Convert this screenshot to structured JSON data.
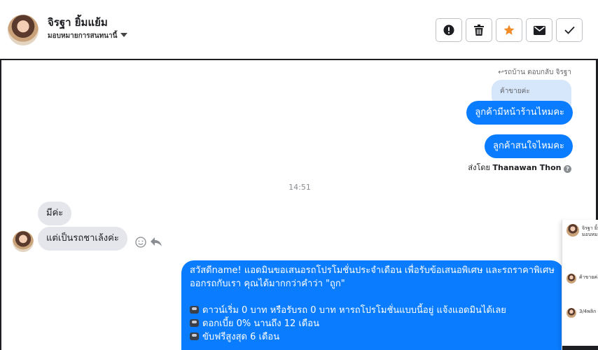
{
  "header": {
    "contact_name": "จิรฐา ยิ้มแย้ม",
    "assign_label": "มอบหมายการสนทนานี้",
    "actions": [
      {
        "name": "spam-button",
        "icon": "alert-icon",
        "color": "#1c1e21"
      },
      {
        "name": "delete-button",
        "icon": "trash-icon",
        "color": "#1c1e21"
      },
      {
        "name": "star-button",
        "icon": "star-icon",
        "color": "#f28c28"
      },
      {
        "name": "mail-button",
        "icon": "mail-icon",
        "color": "#1c1e21"
      },
      {
        "name": "done-button",
        "icon": "check-icon",
        "color": "#1c1e21"
      }
    ]
  },
  "conversation": {
    "reply_label": "↩รถบ้าน ตอบกลับ จิรฐา",
    "quoted_text": "ค้าขายค่ะ",
    "outgoing_1": "ลูกค้ามีหน้าร้านไหมคะ",
    "outgoing_2": "ลูกค้าสนใจไหมคะ",
    "sent_by_prefix": "ส่งโดย",
    "sent_by_name": "Thanawan Thon",
    "timestamp": "14:51",
    "incoming_1": "มีค่ะ",
    "incoming_2": "แต่เป็นรถชาเล้งค่ะ",
    "promo": {
      "intro": "สวัสดีname! แอดมินขอเสนอรถโปรโมชั่นประจำเดือน เพื่อรับข้อเสนอพิเศษ และรถราคาพิเศษ ออกรถกับเรา คุณได้มากกว่าคำว่า \"ถูก\"",
      "bullets": [
        "ดาวน์เริ่ม 0 บาท หรือรับรถ 0 บาท หารถโปรโมชั่นแบบนี้อยู่ แจ้งแอดมินได้เลย",
        "ดอกเบี้ย 0% นานถึง 12 เดือน",
        "ขับฟรีสูงสุด 6 เดือน"
      ]
    }
  },
  "side_panel": {
    "top_name": "จิรฐา ยิ้ม",
    "top_sub": "มอบหมาย",
    "rows": [
      "ค้าขายค่ะ",
      "3/4พลิก"
    ]
  },
  "colors": {
    "accent": "#0a7cff",
    "incoming_bubble": "#e4e6eb",
    "quoted_bubble": "#d6e6fb",
    "star": "#f28c28"
  }
}
